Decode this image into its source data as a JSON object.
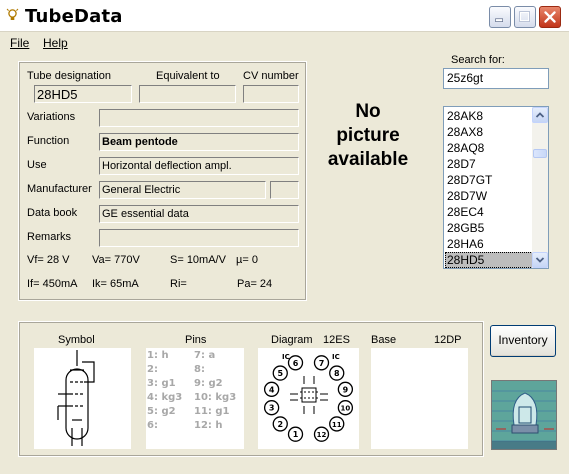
{
  "window": {
    "title": "TubeData",
    "icon": "lightbulb-icon",
    "buttons": [
      "minimize-icon",
      "maximize-icon",
      "close-icon"
    ]
  },
  "menu": {
    "file": "File",
    "help": "Help"
  },
  "labels": {
    "tube_designation": "Tube designation",
    "equivalent_to": "Equivalent to",
    "cv_number": "CV number",
    "variations": "Variations",
    "function": "Function",
    "use": "Use",
    "manufacturer": "Manufacturer",
    "data_book": "Data book",
    "remarks": "Remarks"
  },
  "fields": {
    "tube_designation": "28HD5",
    "equivalent_to": "",
    "cv_number": "",
    "variations": "",
    "function": "Beam pentode",
    "use": "Horizontal deflection ampl.",
    "manufacturer": "General Electric",
    "manufacturer_extra": "",
    "data_book": "GE essential data",
    "remarks": ""
  },
  "params": {
    "vf": "Vf= 28 V",
    "va": "Va= 770V",
    "s": "S= 10mA/V",
    "mu": "µ=   0",
    "if": "If= 450mA",
    "ik": "Ik=  65mA",
    "ri": "Ri=",
    "pa": "Pa= 24"
  },
  "no_picture": [
    "No",
    "picture",
    "available"
  ],
  "search": {
    "label": "Search for:",
    "value": "25z6gt"
  },
  "tube_list": {
    "items": [
      "28AK8",
      "28AX8",
      "28AQ8",
      "28D7",
      "28D7GT",
      "28D7W",
      "28EC4",
      "28GB5",
      "28HA6",
      "28HD5"
    ],
    "selected": "28HD5"
  },
  "bottom": {
    "symbol_label": "Symbol",
    "pins_label": "Pins",
    "diagram_label": "Diagram",
    "diagram_code": "12ES",
    "base_label": "Base",
    "base_code": "12DP",
    "pins_left": [
      "1: h",
      "2:",
      "3: g1",
      "4: kg3",
      "5: g2",
      "6:"
    ],
    "pins_right": [
      "7: a",
      "8:",
      "9: g2",
      "10: kg3",
      "11: g1",
      "12: h"
    ],
    "diagram_pins": [
      "1",
      "2",
      "3",
      "4",
      "5",
      "6",
      "7",
      "8",
      "9",
      "10",
      "11",
      "12"
    ],
    "ic_marks": [
      "IC",
      "IC"
    ]
  },
  "inventory_button": "Inventory",
  "colors": {
    "window_bg": "#ece9d8",
    "selection": "#bdbdbd",
    "close_button": "#c2351a",
    "pins_text": "#a8a8a8",
    "logo_bg": "#5ea59b"
  }
}
